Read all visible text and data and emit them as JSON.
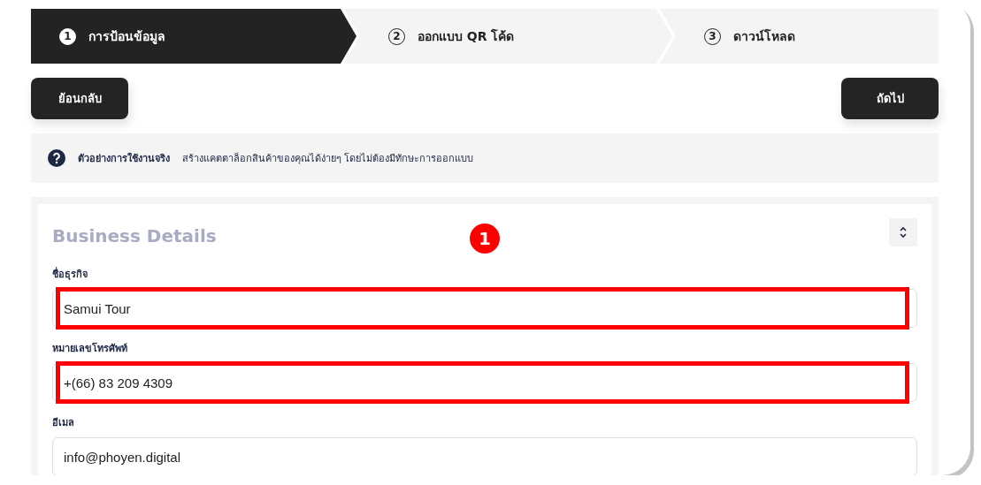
{
  "steps": [
    {
      "number": "1",
      "label": "การป้อนข้อมูล",
      "selected": true
    },
    {
      "number": "2",
      "label": "ออกแบบ QR โค้ด",
      "selected": false
    },
    {
      "number": "3",
      "label": "ดาวน์โหลด",
      "selected": false
    }
  ],
  "nav_buttons": {
    "back": "ย้อนกลับ",
    "next": "ถัดไป"
  },
  "info_bar": {
    "title": "ตัวอย่างการใช้งานจริง",
    "text": "สร้างแคตตาล็อกสินค้าของคุณได้ง่ายๆ โดยไม่ต้องมีทักษะการออกแบบ"
  },
  "section": {
    "title": "Business Details",
    "expanded": true,
    "annotation_marker": "1",
    "fields": [
      {
        "label": "ชื่อธุรกิจ",
        "value": "Samui Tour",
        "highlighted": true
      },
      {
        "label": "หมายเลขโทรศัพท์",
        "value": "+(66) 83 209 4309",
        "highlighted": true
      },
      {
        "label": "อีเมล",
        "value": "info@phoyen.digital",
        "highlighted": false
      }
    ]
  }
}
